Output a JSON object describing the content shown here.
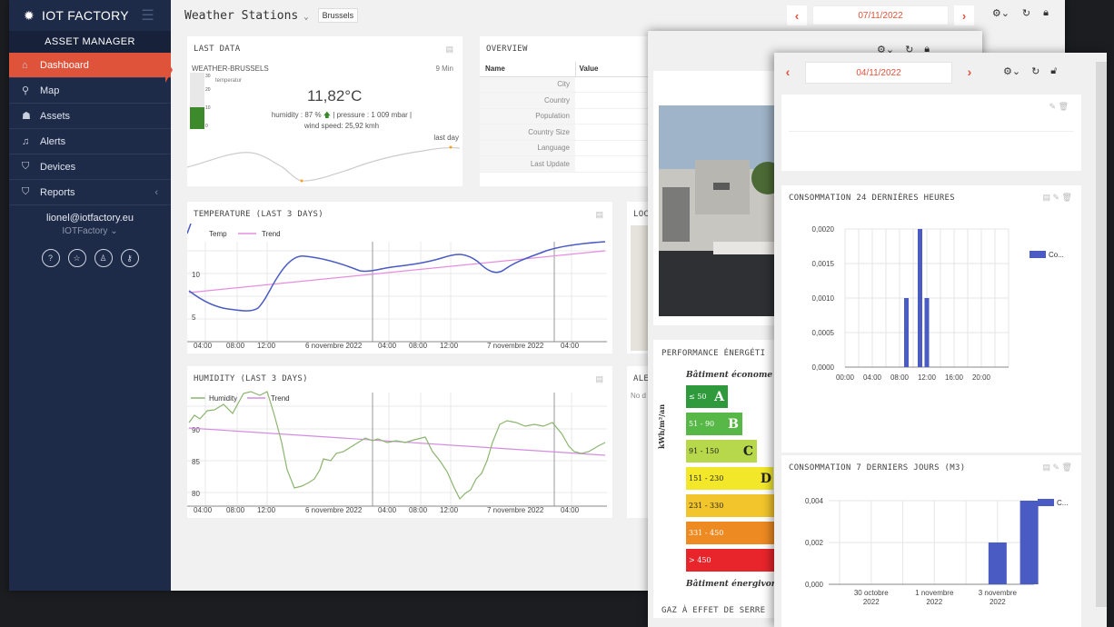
{
  "app": {
    "brand": "IOT FACTORY",
    "section": "ASSET MANAGER"
  },
  "nav": [
    {
      "label": "Dashboard",
      "icon": "home-icon"
    },
    {
      "label": "Map",
      "icon": "pin-icon"
    },
    {
      "label": "Assets",
      "icon": "assets-icon"
    },
    {
      "label": "Alerts",
      "icon": "bell-icon"
    },
    {
      "label": "Devices",
      "icon": "tag-icon"
    },
    {
      "label": "Reports",
      "icon": "tag-icon"
    }
  ],
  "user": {
    "email": "lionel@iotfactory.eu",
    "org": "IOTFactory"
  },
  "header": {
    "title": "Weather Stations",
    "site": "Brussels",
    "date": "07/11/2022"
  },
  "last_data": {
    "title": "LAST DATA",
    "station": "WEATHER-BRUSSELS",
    "age": "9 Min",
    "gauge_label": "temperature",
    "gauge_ticks": [
      "30",
      "20",
      "10",
      "0"
    ],
    "temperature": "11,82°C",
    "humidity": "humidity : 87 %",
    "pressure": "| pressure : 1 009 mbar |",
    "wind": "wind speed: 25,92 kmh",
    "spark_label": "last day"
  },
  "overview": {
    "title": "OVERVIEW",
    "col_name": "Name",
    "col_value": "Value",
    "rows": [
      "City",
      "Country",
      "Population",
      "Country Size",
      "Language",
      "Last Update"
    ]
  },
  "temperature_chart": {
    "title": "TEMPERATURE (LAST 3 DAYS)",
    "legend": [
      "Temp",
      "Trend"
    ],
    "yticks": [
      "10",
      "5"
    ],
    "xticks": [
      "04:00",
      "08:00",
      "12:00",
      "6 novembre 2022",
      "04:00",
      "08:00",
      "12:00",
      "7 novembre 2022",
      "04:00"
    ]
  },
  "humidity_chart": {
    "title": "HUMIDITY (LAST 3 DAYS)",
    "legend": [
      "Humidity",
      "Trend"
    ],
    "yticks": [
      "90",
      "85",
      "80"
    ],
    "xticks": [
      "04:00",
      "08:00",
      "12:00",
      "6 novembre 2022",
      "04:00",
      "08:00",
      "12:00",
      "7 novembre 2022",
      "04:00"
    ]
  },
  "loc_card": {
    "title": "LOC"
  },
  "alerts_card": {
    "title": "ALE",
    "text": "No d"
  },
  "win2": {
    "perf_title": "PERFORMANCE ÉNERGÉTI",
    "dpe_top": "Bâtiment économe",
    "dpe_bottom": "Bâtiment énergivore",
    "dpe_axis": "kWh/m²/an",
    "dpe": [
      {
        "range": "≤ 50",
        "letter": "A",
        "color": "#2e9a3c"
      },
      {
        "range": "51 - 90",
        "letter": "B",
        "color": "#57b847"
      },
      {
        "range": "91 - 150",
        "letter": "C",
        "color": "#b7d84a"
      },
      {
        "range": "151 - 230",
        "letter": "D",
        "color": "#f2e829"
      },
      {
        "range": "231 - 330",
        "letter": "",
        "color": "#f2c52c"
      },
      {
        "range": "331 - 450",
        "letter": "",
        "color": "#ee8a22"
      },
      {
        "range": "> 450",
        "letter": "",
        "color": "#e8252b"
      }
    ],
    "gaz_title": "GAZ À EFFET DE SERRE"
  },
  "win3": {
    "date": "04/11/2022",
    "chart_data": [
      {
        "type": "bar",
        "title": "CONSOMMATION 24 DERNIÈRES HEURES",
        "series": [
          {
            "name": "Co...",
            "x": [
              "09:00",
              "11:00",
              "12:00"
            ],
            "values": [
              0.001,
              0.002,
              0.001
            ]
          }
        ],
        "xticks": [
          "00:00",
          "04:00",
          "08:00",
          "12:00",
          "16:00",
          "20:00"
        ],
        "yticks": [
          "0,0020",
          "0,0015",
          "0,0010",
          "0,0005",
          "0,0000"
        ],
        "ylim": [
          0,
          0.002
        ],
        "legend_position": "right",
        "color": "#4a5bc4"
      },
      {
        "type": "bar",
        "title": "CONSOMMATION 7 DERNIERS JOURS (M3)",
        "series": [
          {
            "name": "C...",
            "x": [
              "3 novembre 2022",
              "4 novembre 2022"
            ],
            "values": [
              0.002,
              0.004
            ]
          }
        ],
        "xticks": [
          "30 octobre 2022",
          "1 novembre 2022",
          "3 novembre 2022"
        ],
        "yticks": [
          "0,004",
          "0,002",
          "0,000"
        ],
        "ylim": [
          0,
          0.004
        ],
        "legend_position": "right",
        "color": "#4a5bc4"
      }
    ]
  }
}
